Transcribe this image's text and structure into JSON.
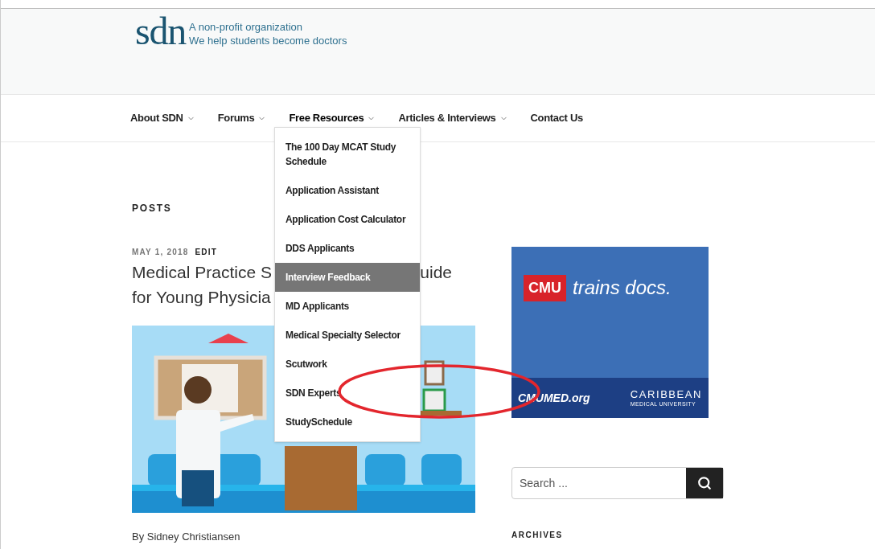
{
  "header": {
    "logo": "sdn",
    "tagline": [
      "A non-profit organization",
      "We help students become doctors"
    ]
  },
  "nav": [
    {
      "label": "About SDN",
      "has_menu": true,
      "expanded": false
    },
    {
      "label": "Forums",
      "has_menu": true,
      "expanded": false
    },
    {
      "label": "Free Resources",
      "has_menu": true,
      "expanded": true
    },
    {
      "label": "Articles & Interviews",
      "has_menu": true,
      "expanded": false
    },
    {
      "label": "Contact Us",
      "has_menu": false,
      "expanded": false
    }
  ],
  "dropdown": [
    {
      "label": "The 100 Day MCAT Study Schedule",
      "selected": false
    },
    {
      "label": "Application Assistant",
      "selected": false
    },
    {
      "label": "Application Cost Calculator",
      "selected": false
    },
    {
      "label": "DDS Applicants",
      "selected": false
    },
    {
      "label": "Interview Feedback",
      "selected": true
    },
    {
      "label": "MD Applicants",
      "selected": false
    },
    {
      "label": "Medical Specialty Selector",
      "selected": false
    },
    {
      "label": "Scutwork",
      "selected": false
    },
    {
      "label": "SDN Experts",
      "selected": false
    },
    {
      "label": "StudySchedule",
      "selected": false
    }
  ],
  "posts": {
    "heading": "POSTS",
    "date": "MAY 1, 2018",
    "edit": "EDIT",
    "title_visible": [
      "Medical Practice S",
      "uide",
      "for Young Physicia"
    ],
    "byline": "By Sidney Christiansen"
  },
  "ad": {
    "badge": "CMU",
    "headline": "trains docs.",
    "site": "CMUMED.org",
    "school": "CARIBBEAN",
    "school_sub": "MEDICAL UNIVERSITY"
  },
  "search": {
    "placeholder": "Search ..."
  },
  "archives": {
    "heading": "ARCHIVES"
  }
}
